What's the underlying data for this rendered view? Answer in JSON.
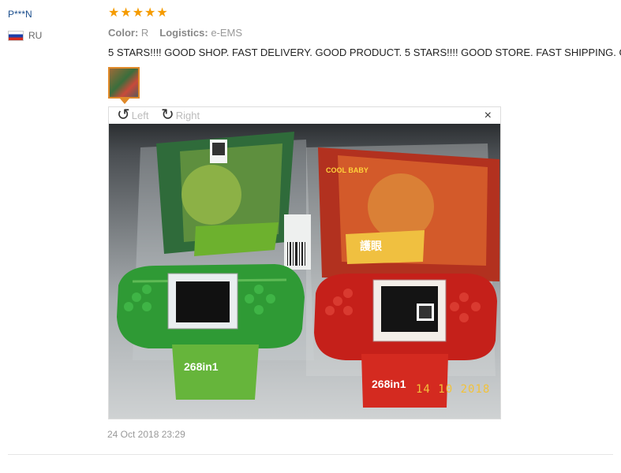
{
  "reviewer": {
    "name": "P***N",
    "country": "RU"
  },
  "rating": {
    "stars": 5,
    "max": 5
  },
  "meta": {
    "color_key": "Color:",
    "color_value": "R",
    "logistics_key": "Logistics:",
    "logistics_value": "e-EMS"
  },
  "review_text": "5 STARS!!!! GOOD SHOP. FAST DELIVERY. GOOD PRODUCT. 5 STARS!!!! GOOD STORE. FAST SHIPPING. GOOD",
  "viewer": {
    "rotate_left": "Left",
    "rotate_right": "Right",
    "close_glyph": "×"
  },
  "photo": {
    "date_stamp": "14 10 2018",
    "green_pack_label": "268in1",
    "red_pack_label": "268in1",
    "banner_text": "護眼",
    "brand_text": "COOL BABY"
  },
  "posted": "24 Oct 2018 23:29",
  "colors": {
    "star": "#f59b00",
    "username": "#1a4d8c",
    "thumb_border": "#e08a2a"
  }
}
